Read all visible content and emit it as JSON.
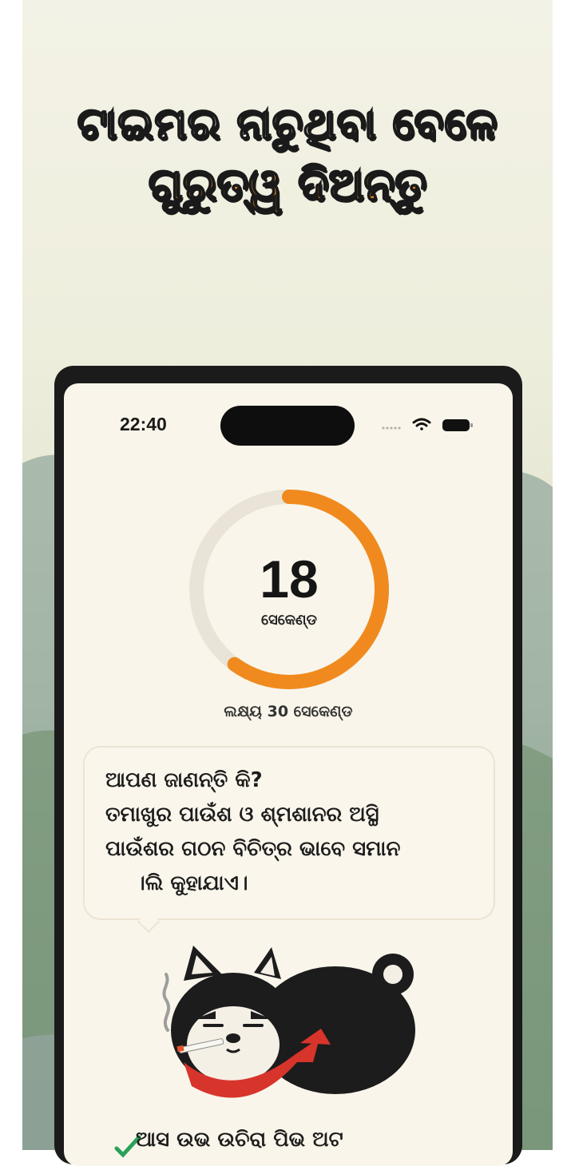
{
  "promo": {
    "headline_line1": "ଟାଇମର ନାଚୁଥିବା ବେଳେ",
    "headline_line2": "ଗୁରୁତ୍ୱ ଦିଅନ୍ତୁ",
    "colors": {
      "headline_accent": "#f08a1e",
      "headline_primary": "#ffffff"
    }
  },
  "status_bar": {
    "time": "22:40",
    "icons": [
      "signal-dots-icon",
      "wifi-icon",
      "battery-icon"
    ]
  },
  "timer": {
    "seconds": "18",
    "unit": "ସେକେଣ୍ଡ",
    "goal": "ଲକ୍ଷ୍ୟ 30 ସେକେଣ୍ଡ",
    "progress_fraction": 0.6,
    "colors": {
      "progress": "#f08a1e",
      "track": "#e9e4d7"
    }
  },
  "fact_bubble": {
    "line1": "ଆପଣ ଜାଣନ୍ତି କି?",
    "line2": "ତମାଖୁର ପାଉଁଶ ଓ ଶ୍ମଶାନର ଅସ୍ଥି",
    "line3": "ପାଉଁଶର ଗଠନ ବିଚିତ୍ର ଭାବେ ସମାନ",
    "line4": "।ଲି କୁହାଯାଏ।"
  },
  "mascot": {
    "icon": "smoking-dog-mascot-icon"
  },
  "bottom": {
    "text": "ଆସ ଉଭ ଉଚିରା ପିଭ ଅଟ"
  }
}
